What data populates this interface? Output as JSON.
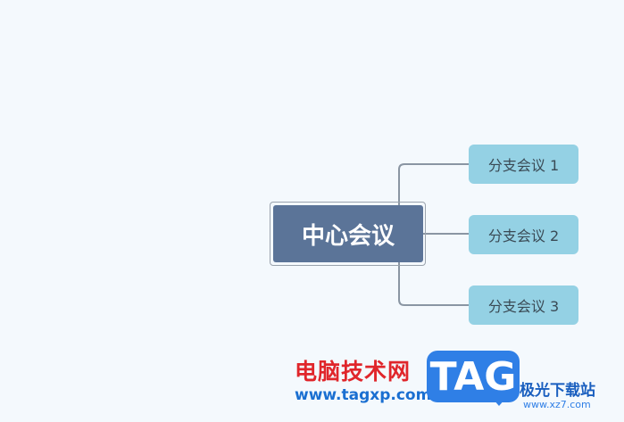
{
  "mindmap": {
    "central_topic": "中心会议",
    "branches": [
      {
        "label": "分支会议 1"
      },
      {
        "label": "分支会议 2"
      },
      {
        "label": "分支会议 3"
      }
    ]
  },
  "watermark": {
    "site_name": "电脑技术网",
    "site_url": "www.tagxp.com",
    "tag_text": "TAG",
    "brand_name": "极光下载站",
    "brand_url": "www.xz7.com"
  },
  "colors": {
    "background": "#f4f9fd",
    "central_topic_fill": "#5b7498",
    "branch_fill": "#94d1e4",
    "connector": "#8a96a3"
  }
}
